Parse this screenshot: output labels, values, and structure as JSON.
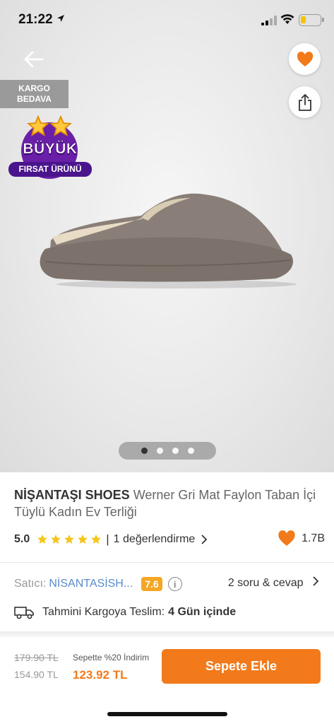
{
  "status_bar": {
    "time": "21:22"
  },
  "badges": {
    "cargo_line1": "KARGO",
    "cargo_line2": "BEDAVA",
    "deal_line1": "BÜYÜK",
    "deal_line2": "FIRSAT ÜRÜNÜ"
  },
  "gallery": {
    "slide_count": 4,
    "active_index": 0
  },
  "product": {
    "brand": "NİŞANTAŞI SHOES",
    "name": "Werner Gri Mat Faylon Taban İçi Tüylü Kadın Ev Terliği",
    "rating": "5.0",
    "stars": 5,
    "reviews_label": "1 değerlendirme",
    "likes": "1.7B"
  },
  "seller": {
    "label": "Satıcı:",
    "name": "NİSANTASİSH...",
    "score": "7.6",
    "qa_label": "2 soru & cevap"
  },
  "delivery": {
    "label": "Tahmini Kargoya Teslim:",
    "value": "4 Gün içinde"
  },
  "pricing": {
    "original_price": "179.90 TL",
    "sale_price": "154.90 TL",
    "promo_label": "Sepette %20 İndirim",
    "basket_price": "123.92 TL"
  },
  "cta": {
    "add_to_cart": "Sepete Ekle"
  },
  "colors": {
    "accent": "#f27a1a",
    "star": "#f5c518",
    "seller_link": "#5a8bc9",
    "score_badge": "#f5a623"
  },
  "icons": [
    "back-arrow-icon",
    "heart-icon",
    "share-icon",
    "star-icon",
    "chevron-right-icon",
    "info-icon",
    "truck-icon"
  ]
}
